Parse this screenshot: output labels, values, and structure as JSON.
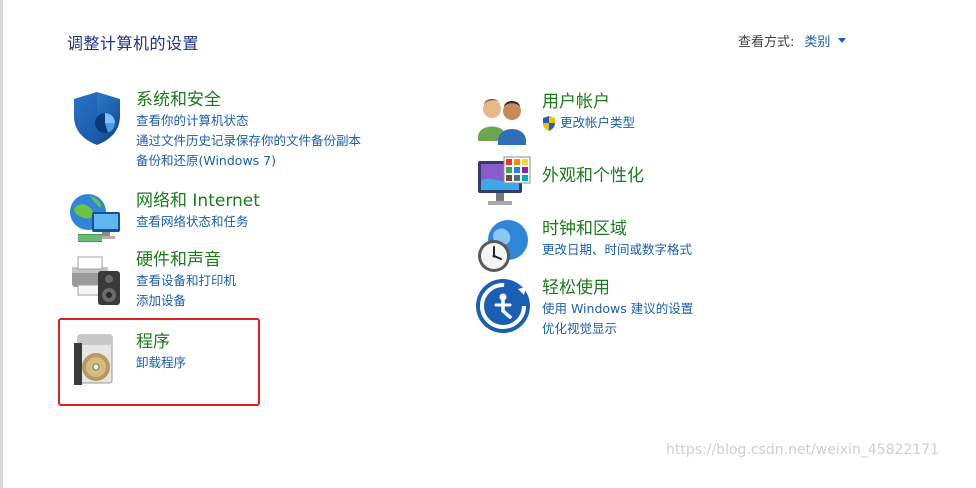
{
  "header": {
    "title": "调整计算机的设置",
    "view_by_label": "查看方式:",
    "view_by_value": "类别"
  },
  "categories": [
    {
      "title": "系统和安全",
      "icon": "security-shield-icon",
      "links": [
        "查看你的计算机状态",
        "通过文件历史记录保存你的文件备份副本",
        "备份和还原(Windows 7)"
      ]
    },
    {
      "title": "网络和 Internet",
      "icon": "network-globe-icon",
      "links": [
        "查看网络状态和任务"
      ]
    },
    {
      "title": "硬件和声音",
      "icon": "printer-speaker-icon",
      "links": [
        "查看设备和打印机",
        "添加设备"
      ]
    },
    {
      "title": "程序",
      "icon": "programs-disc-icon",
      "links": [
        "卸载程序"
      ]
    },
    {
      "title": "用户帐户",
      "icon": "user-accounts-icon",
      "links": [
        "更改帐户类型"
      ]
    },
    {
      "title": "外观和个性化",
      "icon": "monitor-palette-icon",
      "links": []
    },
    {
      "title": "时钟和区域",
      "icon": "clock-globe-icon",
      "links": [
        "更改日期、时间或数字格式"
      ]
    },
    {
      "title": "轻松使用",
      "icon": "ease-of-access-icon",
      "links": [
        "使用 Windows 建议的设置",
        "优化视觉显示"
      ]
    }
  ],
  "colors": {
    "title_text": "#1e3287",
    "category_title": "#1a7d1a",
    "link": "#1a5fb4",
    "highlight_border": "#e02020"
  },
  "watermark": "https://blog.csdn.net/weixin_45822171"
}
